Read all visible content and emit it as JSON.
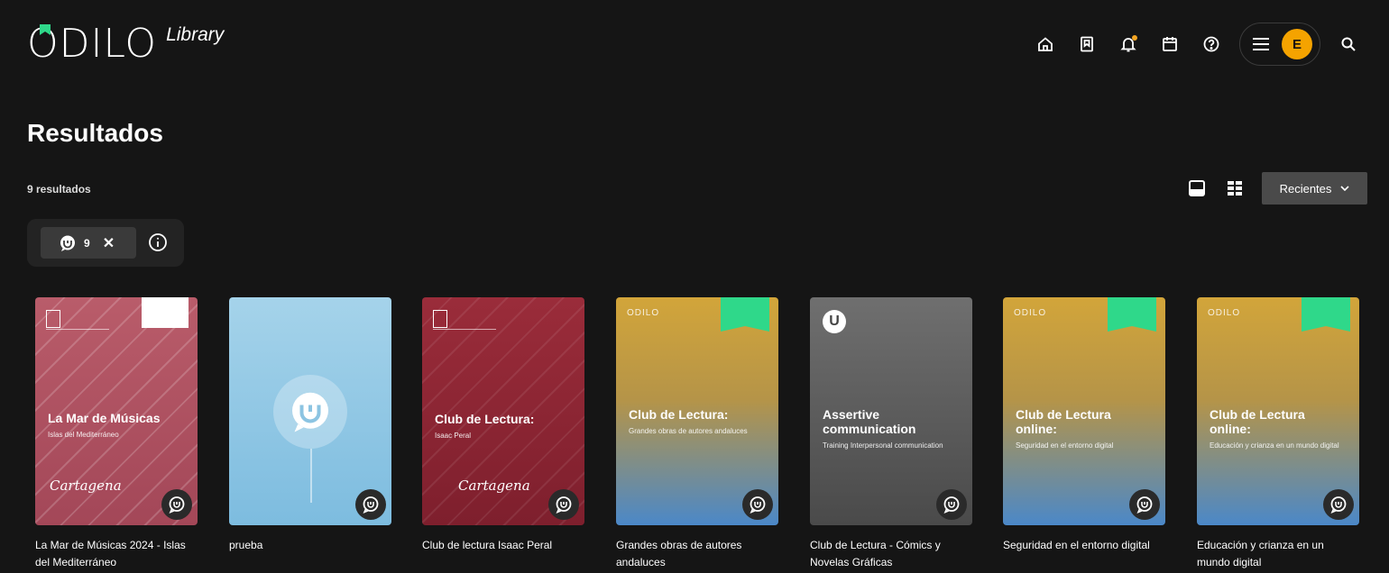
{
  "header": {
    "logo_main": "ODILO",
    "logo_sub": "Library",
    "nav": [
      "home-icon",
      "bookmark-icon",
      "bell-icon",
      "calendar-icon",
      "help-icon"
    ],
    "avatar_initial": "E",
    "accent": "#f5a300"
  },
  "results": {
    "title": "Resultados",
    "count_text": "9 resultados",
    "sort_label": "Recientes"
  },
  "filter": {
    "chip_count": "9"
  },
  "cards": [
    {
      "title": "La Mar de Músicas 2024 - Islas del Mediterráneo",
      "cover_title": "La Mar de Músicas",
      "cover_sub": "Islas del Mediterráneo",
      "cover_sig": "Cartagena"
    },
    {
      "title": "prueba"
    },
    {
      "title": "Club de lectura Isaac Peral",
      "cover_title": "Club de Lectura:",
      "cover_sub": "Isaac Peral",
      "cover_sig": "Cartagena"
    },
    {
      "title": "Grandes obras de autores andaluces",
      "cover_title": "Club de Lectura:",
      "cover_sub": "Grandes obras de autores andaluces",
      "cover_brand": "ODILO"
    },
    {
      "title": "Club de Lectura - Cómics y Novelas Gráficas",
      "cover_title": "Assertive communication",
      "cover_sub": "Training Interpersonal communication"
    },
    {
      "title": "Seguridad en el entorno digital",
      "cover_title": "Club de Lectura online:",
      "cover_sub": "Seguridad en el entorno digital",
      "cover_brand": "ODILO"
    },
    {
      "title": "Educación y crianza en un mundo digital",
      "cover_title": "Club de Lectura online:",
      "cover_sub": "Educación y crianza en un mundo digital",
      "cover_brand": "ODILO"
    }
  ]
}
